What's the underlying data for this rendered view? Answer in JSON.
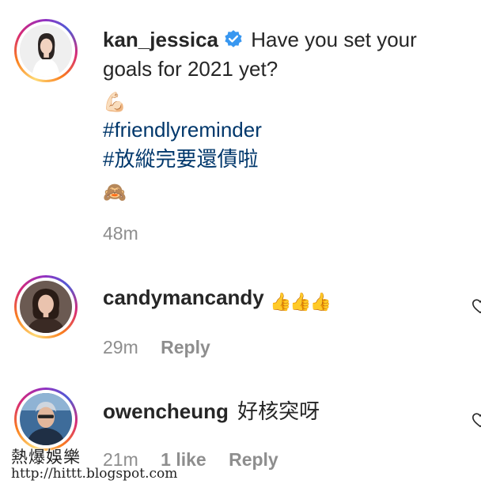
{
  "post": {
    "username": "kan_jessica",
    "verified_icon": "verified-badge-icon",
    "caption_line1": "Have you set your",
    "caption_line2": "goals for 2021 yet?",
    "emoji1": "💪🏻",
    "hashtag1": "#friendlyreminder",
    "hashtag2": "#放縱完要還債啦",
    "emoji2": "🙈",
    "time": "48m"
  },
  "comments": [
    {
      "username": "candymancandy",
      "text": "👍👍👍",
      "time": "29m",
      "reply_label": "Reply"
    },
    {
      "username": "owencheung",
      "text": "好核突呀",
      "time": "21m",
      "likes": "1 like",
      "reply_label": "Reply"
    }
  ],
  "watermark": {
    "title": "熱爆娛樂",
    "url": "http://hittt.blogspot.com"
  },
  "colors": {
    "text": "#262626",
    "muted": "#8e8e8e",
    "hashtag": "#00376b",
    "verified": "#3897f0"
  }
}
